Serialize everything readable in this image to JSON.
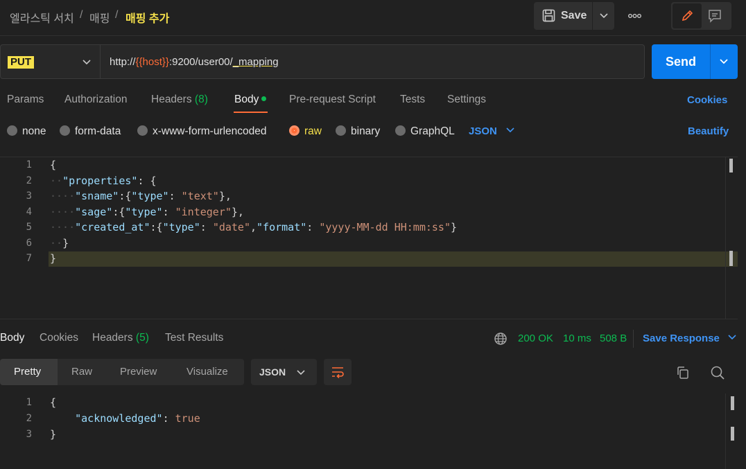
{
  "breadcrumb": {
    "items": [
      "엘라스틱 서치",
      "매핑"
    ],
    "current": "매핑 추가",
    "separator": "/"
  },
  "toolbar": {
    "save_label": "Save"
  },
  "request": {
    "method": "PUT",
    "url": {
      "prefix": "http://",
      "variable": "{{host}}",
      "middle": ":9200/user00/",
      "path_end": "_mapping"
    },
    "send_label": "Send"
  },
  "request_tabs": {
    "params": "Params",
    "authorization": "Authorization",
    "headers": "Headers",
    "headers_count": "(8)",
    "body": "Body",
    "prerequest": "Pre-request Script",
    "tests": "Tests",
    "settings": "Settings",
    "cookies": "Cookies"
  },
  "body_types": {
    "none": "none",
    "form_data": "form-data",
    "urlencoded": "x-www-form-urlencoded",
    "raw": "raw",
    "binary": "binary",
    "graphql": "GraphQL",
    "language": "JSON",
    "beautify": "Beautify"
  },
  "request_body": {
    "line_numbers": [
      "1",
      "2",
      "3",
      "4",
      "5",
      "6",
      "7"
    ],
    "open_brace": "{",
    "close_brace": "}",
    "properties_key": "\"properties\"",
    "sname_key": "\"sname\"",
    "sage_key": "\"sage\"",
    "created_key": "\"created_at\"",
    "type_key": "\"type\"",
    "format_key": "\"format\"",
    "text_val": "\"text\"",
    "integer_val": "\"integer\"",
    "date_val": "\"date\"",
    "format_val": "\"yyyy-MM-dd HH:mm:ss\""
  },
  "response_tabs": {
    "body": "Body",
    "cookies": "Cookies",
    "headers": "Headers",
    "headers_count": "(5)",
    "test_results": "Test Results"
  },
  "response_status": {
    "status": "200 OK",
    "time": "10 ms",
    "size": "508 B",
    "save_response": "Save Response"
  },
  "response_format": {
    "pretty": "Pretty",
    "raw": "Raw",
    "preview": "Preview",
    "visualize": "Visualize",
    "language": "JSON"
  },
  "response_body": {
    "line_numbers": [
      "1",
      "2",
      "3"
    ],
    "open_brace": "{",
    "close_brace": "}",
    "ack_key": "\"acknowledged\"",
    "ack_val": "true"
  },
  "colors": {
    "accent": "#ff6c37",
    "send": "#097bed",
    "success": "#0cbb52",
    "highlight": "#f5e04b",
    "link": "#3f94f5"
  }
}
